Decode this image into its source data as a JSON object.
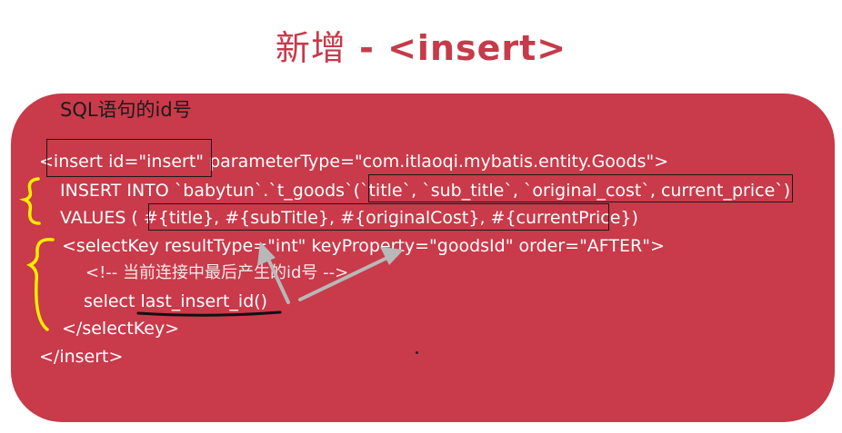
{
  "slide": {
    "title_cn": "新增",
    "title_sep": " - ",
    "title_code": "<insert>"
  },
  "annotation": {
    "label": "SQL语句的id号"
  },
  "code": {
    "line1": "<insert id=\"insert\" parameterType=\"com.itlaoqi.mybatis.entity.Goods\">",
    "line2": "INSERT INTO `babytun`.`t_goods`(`title`, `sub_title`, `original_cost`, current_price`)",
    "line3": "VALUES ( #{title}, #{subTitle}, #{originalCost}, #{currentPrice})",
    "line4": "<selectKey resultType=\"int\" keyProperty=\"goodsId\" order=\"AFTER\">",
    "line5": "<!-- 当前连接中最后产生的id号 -->",
    "line6": "select last_insert_id()",
    "line7": "</selectKey>",
    "line8": "</insert>"
  },
  "colors": {
    "panel": "#c93a4a",
    "title": "#c63a4a",
    "bracket": "#ffee00",
    "arrow": "#b8b8b8"
  }
}
